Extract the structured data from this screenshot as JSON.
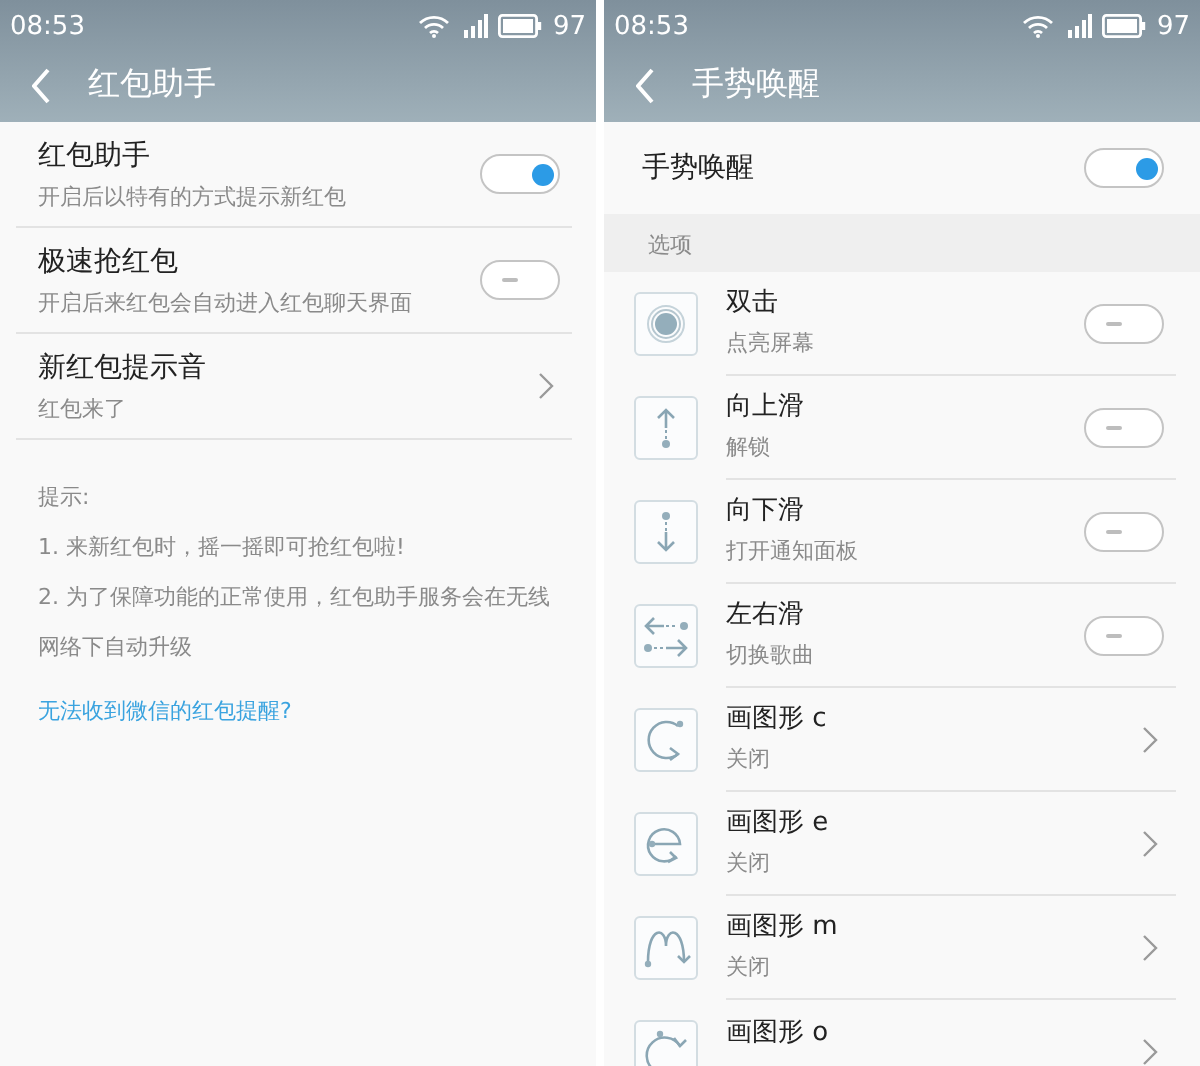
{
  "screens": [
    {
      "status_bar": {
        "time": "08:53",
        "battery": "97"
      },
      "title": "红包助手",
      "items": [
        {
          "kind": "toggle",
          "title": "红包助手",
          "subtitle": "开启后以特有的方式提示新红包",
          "on": true
        },
        {
          "kind": "toggle",
          "title": "极速抢红包",
          "subtitle": "开启后来红包会自动进入红包聊天界面",
          "on": false
        },
        {
          "kind": "link",
          "title": "新红包提示音",
          "subtitle": "红包来了"
        }
      ],
      "tips": [
        "提示:",
        "1. 来新红包时，摇一摇即可抢红包啦!",
        "2. 为了保障功能的正常使用，红包助手服务会在无线网络下自动升级"
      ],
      "help_link": "无法收到微信的红包提醒?"
    },
    {
      "status_bar": {
        "time": "08:53",
        "battery": "97"
      },
      "title": "手势唤醒",
      "items": [
        {
          "kind": "toggle",
          "title": "手势唤醒",
          "on": true
        }
      ],
      "section_label": "选项",
      "options": [
        {
          "kind": "toggle",
          "title": "双击",
          "subtitle": "点亮屏幕",
          "on": false
        },
        {
          "kind": "toggle",
          "title": "向上滑",
          "subtitle": "解锁",
          "on": false
        },
        {
          "kind": "toggle",
          "title": "向下滑",
          "subtitle": "打开通知面板",
          "on": false
        },
        {
          "kind": "toggle",
          "title": "左右滑",
          "subtitle": "切换歌曲",
          "on": false
        },
        {
          "kind": "link",
          "title": "画图形 c",
          "subtitle": "关闭"
        },
        {
          "kind": "link",
          "title": "画图形 e",
          "subtitle": "关闭"
        },
        {
          "kind": "link",
          "title": "画图形 m",
          "subtitle": "关闭"
        },
        {
          "kind": "link",
          "title": "画图形 o"
        }
      ]
    }
  ]
}
